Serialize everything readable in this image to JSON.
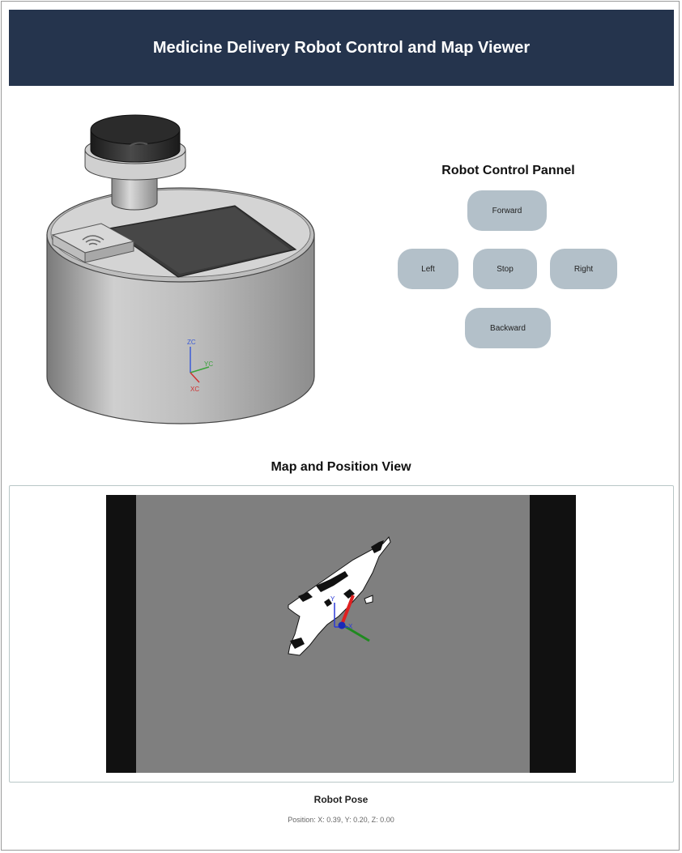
{
  "header": {
    "title": "Medicine Delivery Robot Control and Map Viewer"
  },
  "robot_model": {
    "axis_labels": {
      "z": "ZC",
      "y": "YC",
      "x": "XC"
    }
  },
  "control_panel": {
    "title": "Robot Control Pannel",
    "buttons": {
      "forward": "Forward",
      "left": "Left",
      "stop": "Stop",
      "right": "Right",
      "backward": "Backward"
    }
  },
  "map": {
    "title": "Map and Position View",
    "axis_labels": {
      "y": "Y",
      "x": "X"
    }
  },
  "pose": {
    "title": "Robot Pose",
    "position_text": "Position: X: 0.39, Y: 0.20, Z: 0.00"
  },
  "colors": {
    "header_bg": "#25344d",
    "button_bg": "#b3c0c9",
    "map_free": "#7f7f7f",
    "map_border": "#111111"
  }
}
